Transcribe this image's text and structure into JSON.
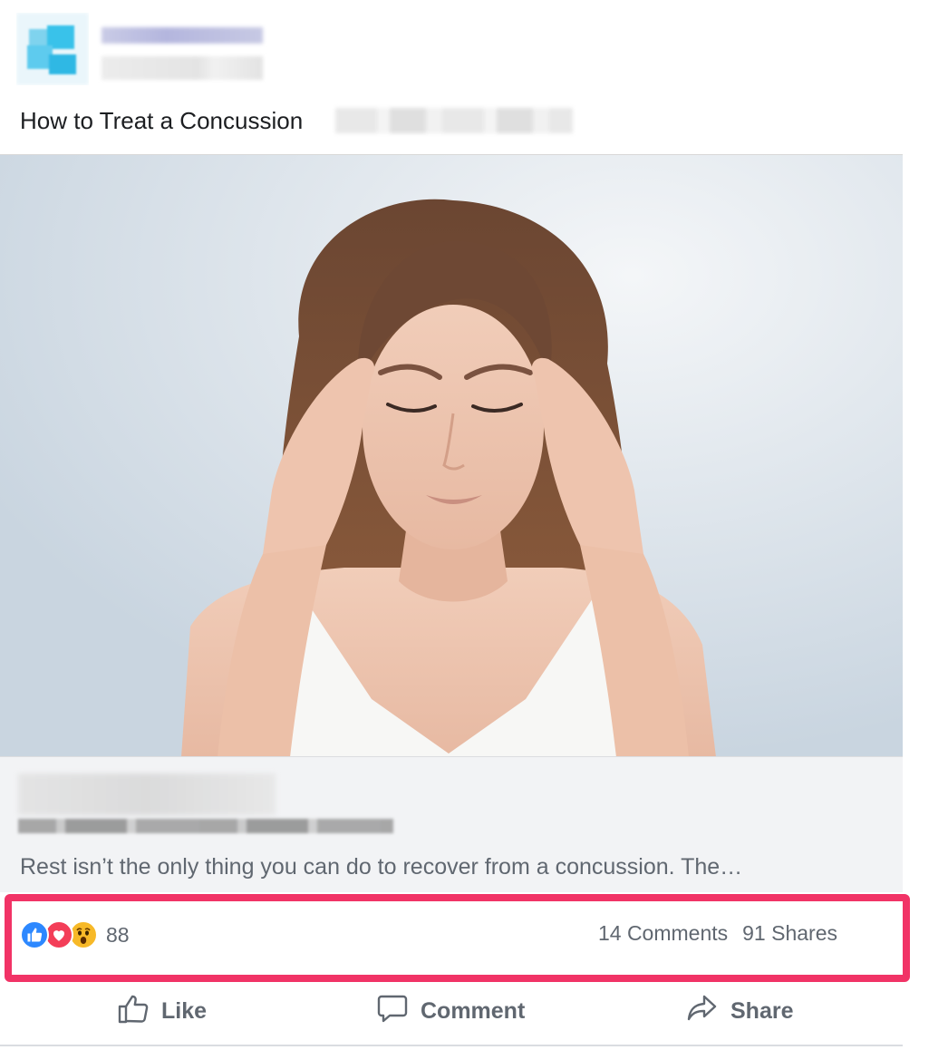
{
  "post": {
    "text": "How to Treat a Concussion"
  },
  "link_preview": {
    "description": "Rest isn’t the only thing you can do to recover from a concussion. The…"
  },
  "reactions": {
    "icons": [
      "like-icon",
      "love-icon",
      "wow-icon"
    ],
    "count": "88",
    "comments": "14 Comments",
    "shares": "91 Shares"
  },
  "actions": {
    "like": "Like",
    "comment": "Comment",
    "share": "Share"
  },
  "colors": {
    "highlight": "#f13366",
    "like": "#2d88ff",
    "love": "#f33e58",
    "wow": "#f7b928",
    "secondary_text": "#606770"
  }
}
